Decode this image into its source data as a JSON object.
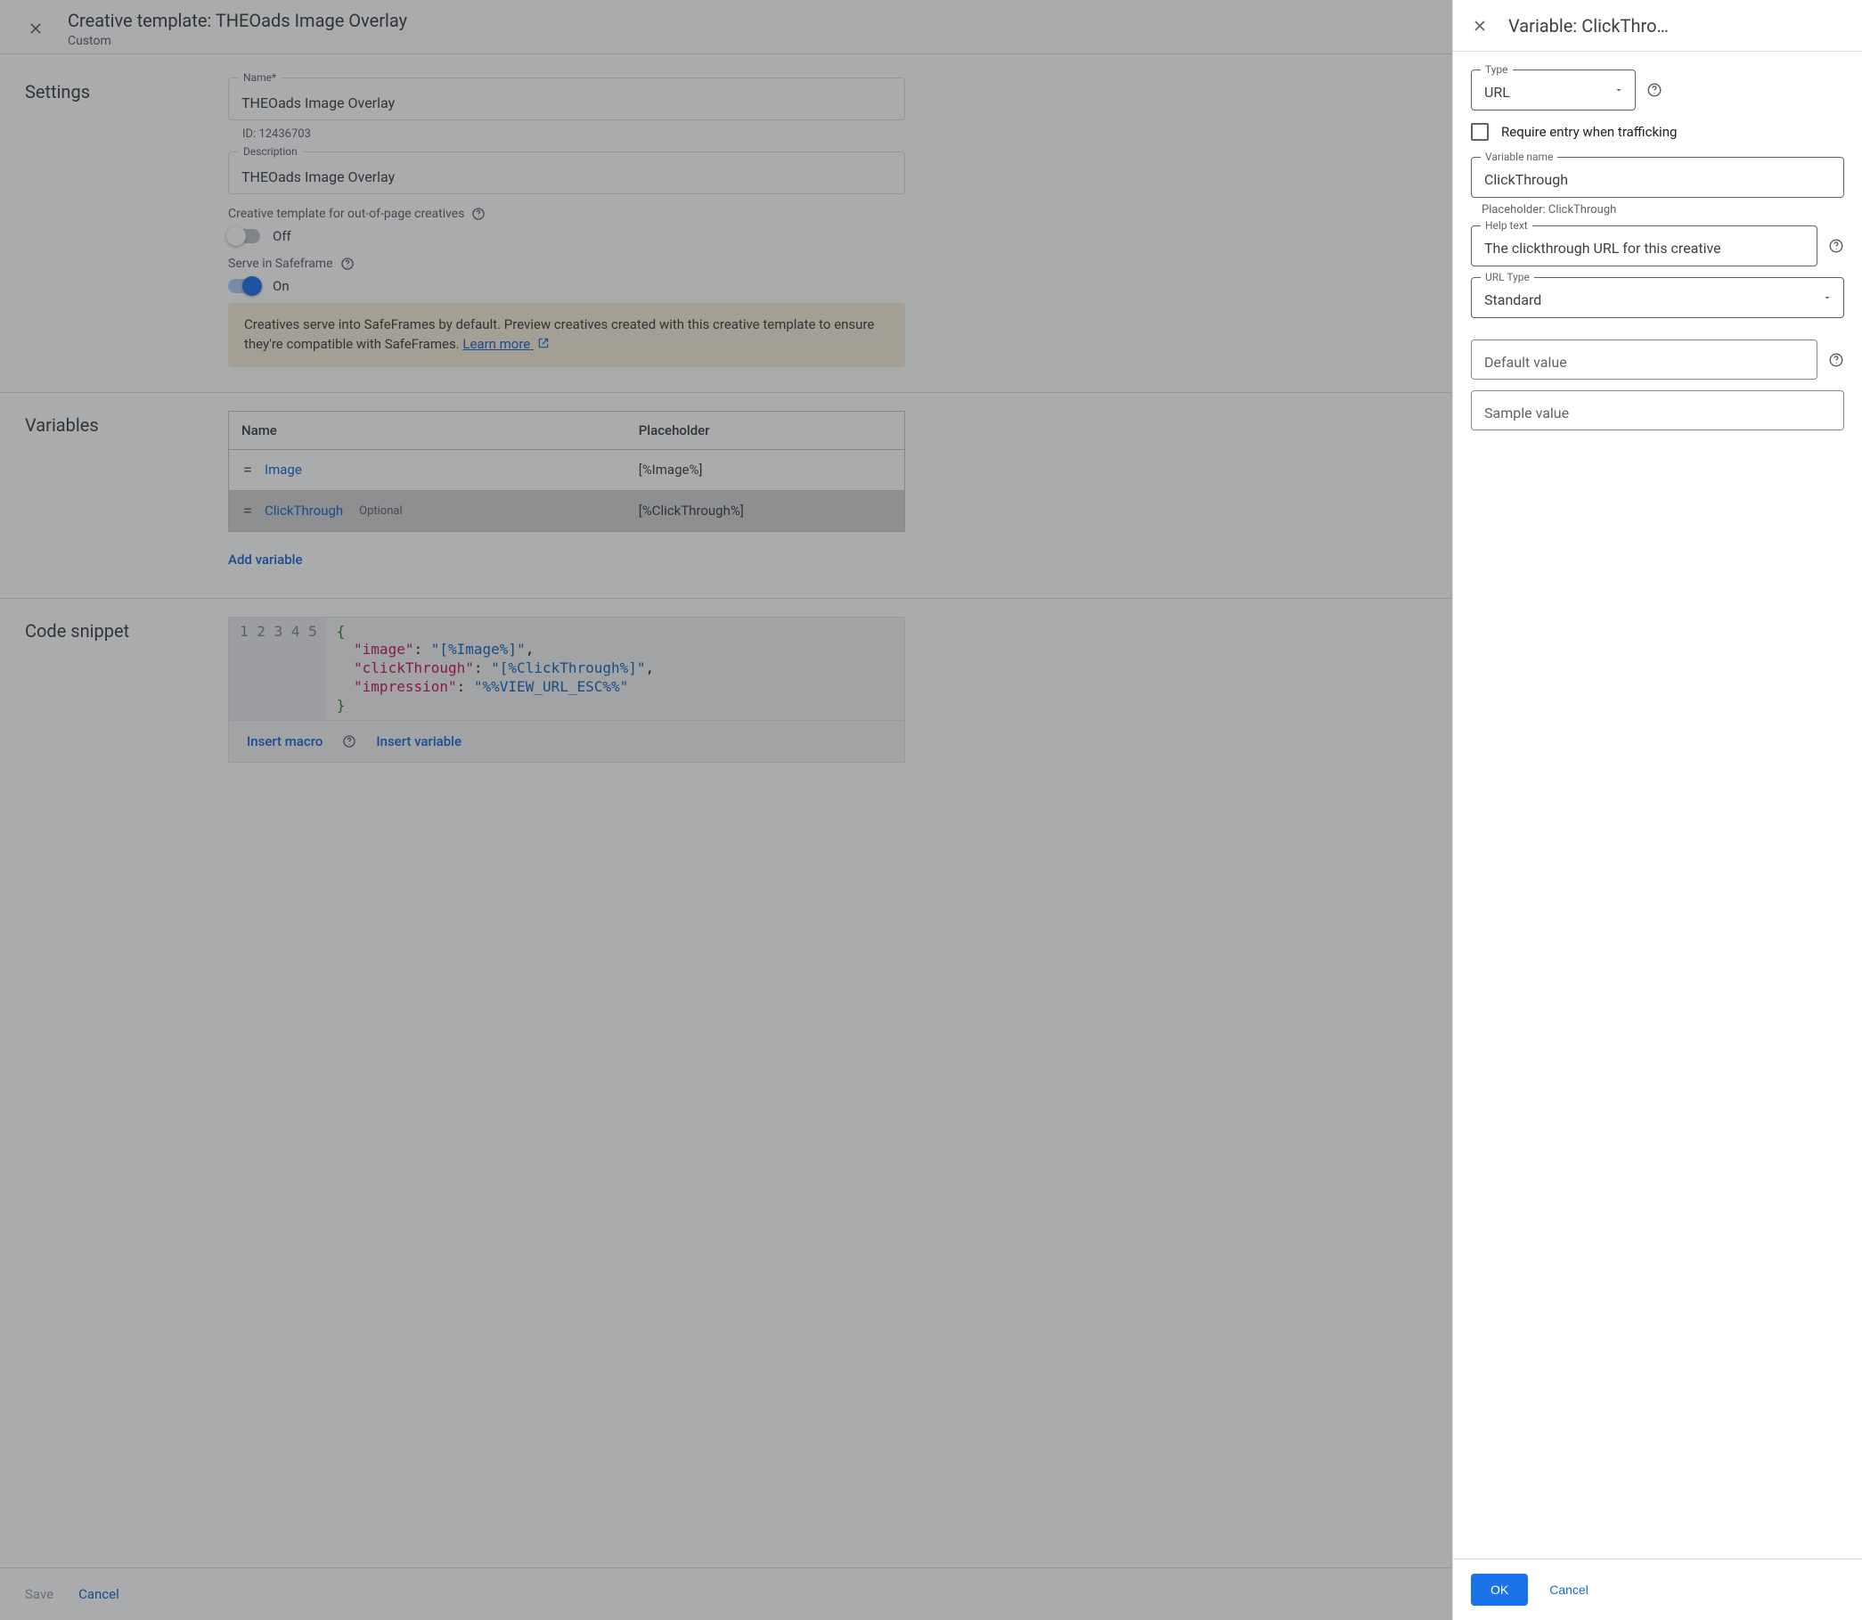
{
  "header": {
    "title": "Creative template: THEOads Image Overlay",
    "subtitle": "Custom"
  },
  "settings": {
    "section_label": "Settings",
    "name_label": "Name*",
    "name_value": "THEOads Image Overlay",
    "id_text": "ID: 12436703",
    "description_label": "Description",
    "description_value": "THEOads Image Overlay",
    "oop_label": "Creative template for out-of-page creatives",
    "oop_state": "Off",
    "safeframe_label": "Serve in Safeframe",
    "safeframe_state": "On",
    "warn_text": "Creatives serve into SafeFrames by default. Preview creatives created with this creative template to ensure they're compatible with SafeFrames. ",
    "learn_more": "Learn more"
  },
  "variables": {
    "section_label": "Variables",
    "cols": {
      "name": "Name",
      "placeholder": "Placeholder"
    },
    "rows": [
      {
        "name": "Image",
        "placeholder": "[%Image%]",
        "optional": false
      },
      {
        "name": "ClickThrough",
        "placeholder": "[%ClickThrough%]",
        "optional": true
      }
    ],
    "optional_tag": "Optional",
    "add": "Add variable"
  },
  "snippet": {
    "section_label": "Code snippet",
    "lines": [
      {
        "n": "1",
        "type": "brace",
        "text": "{"
      },
      {
        "n": "2",
        "type": "kv",
        "key": "\"image\"",
        "sep": ": ",
        "val": "\"[%Image%]\"",
        "tail": ","
      },
      {
        "n": "3",
        "type": "kv",
        "key": "\"clickThrough\"",
        "sep": ": ",
        "val": "\"[%ClickThrough%]\"",
        "tail": ","
      },
      {
        "n": "4",
        "type": "kv",
        "key": "\"impression\"",
        "sep": ": ",
        "val": "\"%%VIEW_URL_ESC%%\"",
        "tail": ""
      },
      {
        "n": "5",
        "type": "brace",
        "text": "}"
      }
    ],
    "insert_macro": "Insert macro",
    "insert_variable": "Insert variable"
  },
  "bottom": {
    "save": "Save",
    "cancel": "Cancel"
  },
  "panel": {
    "title": "Variable: ClickThro…",
    "type_label": "Type",
    "type_value": "URL",
    "require_label": "Require entry when trafficking",
    "varname_label": "Variable name",
    "varname_value": "ClickThrough",
    "varname_subtext": "Placeholder: ClickThrough",
    "helptext_label": "Help text",
    "helptext_value": "The clickthrough URL for this creative",
    "urltype_label": "URL Type",
    "urltype_value": "Standard",
    "default_label": "Default value",
    "sample_label": "Sample value",
    "ok": "OK",
    "cancel": "Cancel"
  }
}
